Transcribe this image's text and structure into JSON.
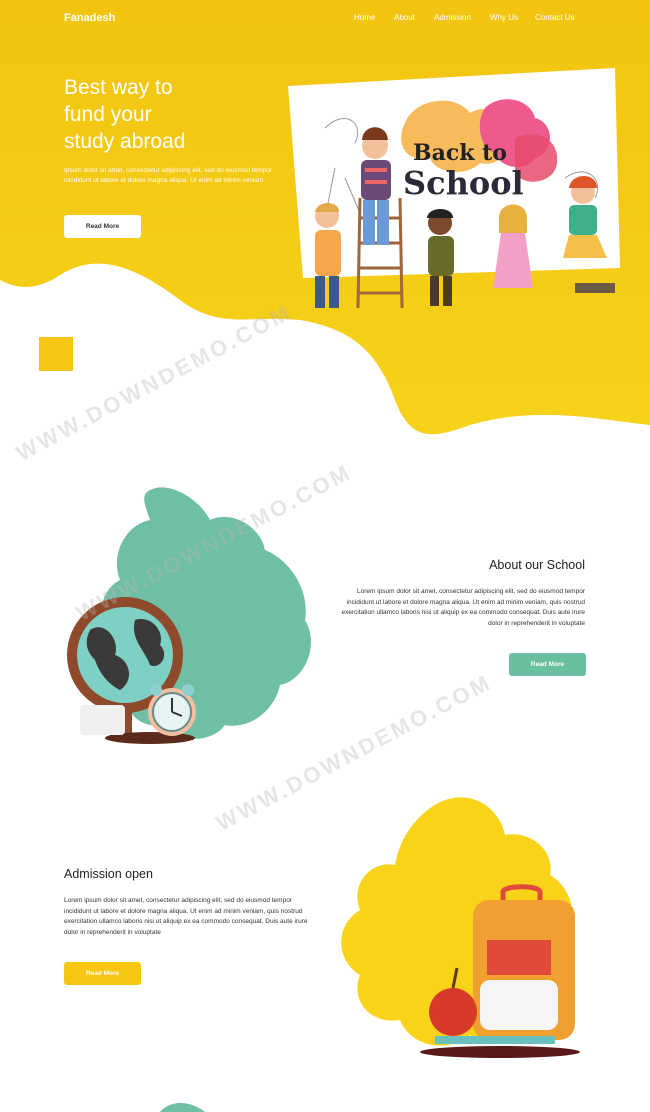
{
  "header": {
    "brand": "Fanadesh",
    "nav": [
      "Home",
      "About",
      "Admission",
      "Why Us",
      "Contact Us"
    ]
  },
  "hero": {
    "title_lines": [
      "Best way to",
      "fund your",
      "study abroad"
    ],
    "text": "Ipsum dolor sit amet, consectetur adipiscing elit, sed do eiusmod tempor incididunt ut labore et dolore magna aliqua. Ut enim ad minim veniam",
    "button": "Read More",
    "illustration_text_1": "Back to",
    "illustration_text_2": "School"
  },
  "about": {
    "title": "About our School",
    "text": "Lorem ipsum dolor sit amet, consectetur adipiscing elit, sed do eiusmod tempor incididunt ut labore et dolore magna aliqua. Ut enim ad minim veniam, quis nostrud exercitation ullamco laboris nisi ut aliquip ex ea commodo consequat. Duis aute irure dolor in reprehenderit in voluptate",
    "button": "Read More"
  },
  "admission": {
    "title": "Admission open",
    "text": "Lorem ipsum dolor sit amet, consectetur adipiscing elit, sed do eiusmod tempor incididunt ut labore et dolore magna aliqua. Ut enim ad minim veniam, quis nostrud exercitation ullamco laboris nisi ut aliquip ex ea commodo consequat. Duis aute irure dolor in reprehenderit in voluptate",
    "button": "Read More"
  },
  "watermark": "WWW.DOWNDEMO.COM",
  "colors": {
    "primary_yellow": "#f6c612",
    "teal": "#6abf9f"
  }
}
